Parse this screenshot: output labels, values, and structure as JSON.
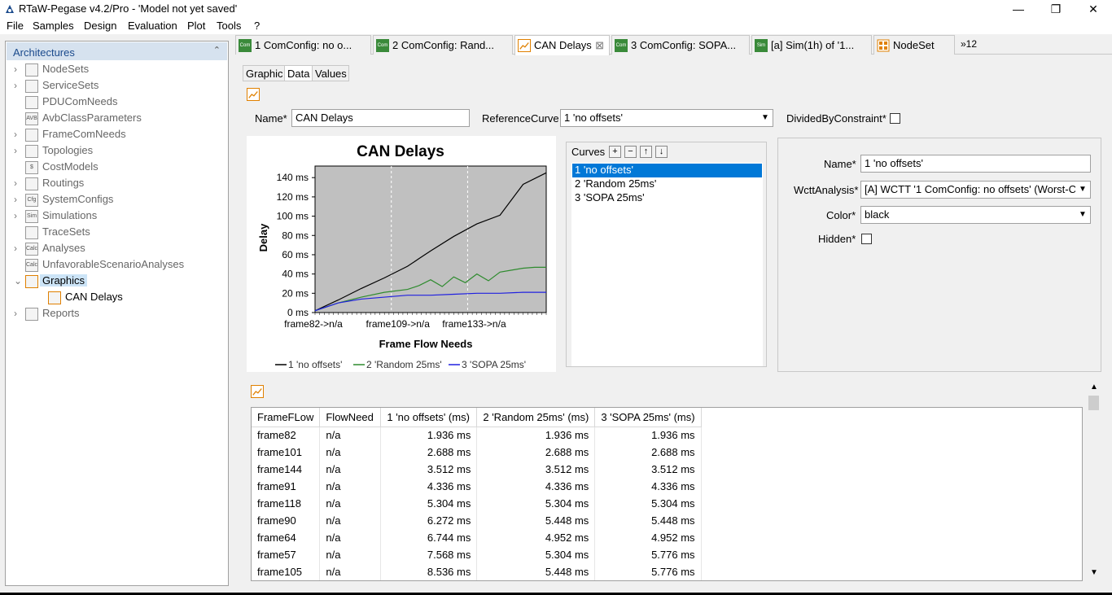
{
  "window": {
    "title": "RTaW-Pegase v4.2/Pro - 'Model not yet saved'",
    "minimize": "—",
    "maximize": "❐",
    "close": "✕"
  },
  "menu": [
    "File",
    "Samples",
    "Design",
    "Evaluation",
    "Plot",
    "Tools",
    "?"
  ],
  "sidebar": {
    "header": "Architectures",
    "items": [
      {
        "label": "NodeSets",
        "icon": "nodeset-icon",
        "badge": ""
      },
      {
        "label": "ServiceSets",
        "icon": "serviceset-icon",
        "badge": ""
      },
      {
        "label": "PDUComNeeds",
        "icon": "pdu-icon",
        "badge": ""
      },
      {
        "label": "AvbClassParameters",
        "icon": "avb-icon",
        "badge": "AVB"
      },
      {
        "label": "FrameComNeeds",
        "icon": "framecom-icon",
        "badge": ""
      },
      {
        "label": "Topologies",
        "icon": "topology-icon",
        "badge": ""
      },
      {
        "label": "CostModels",
        "icon": "cost-icon",
        "badge": "$"
      },
      {
        "label": "Routings",
        "icon": "routing-icon",
        "badge": ""
      },
      {
        "label": "SystemConfigs",
        "icon": "sysconfig-icon",
        "badge": "Cfg"
      },
      {
        "label": "Simulations",
        "icon": "simulation-icon",
        "badge": "Sim"
      },
      {
        "label": "TraceSets",
        "icon": "traceset-icon",
        "badge": ""
      },
      {
        "label": "Analyses",
        "icon": "analysis-icon",
        "badge": "Calc"
      },
      {
        "label": "UnfavorableScenarioAnalyses",
        "icon": "unfavorable-icon",
        "badge": "Calc"
      },
      {
        "label": "Graphics",
        "icon": "graphics-icon",
        "badge": ""
      },
      {
        "label": "CAN Delays",
        "icon": "chart-icon",
        "badge": ""
      },
      {
        "label": "Reports",
        "icon": "report-icon",
        "badge": ""
      }
    ]
  },
  "tabs": [
    {
      "label": "1 ComConfig: no o...",
      "badge": "Com"
    },
    {
      "label": "2 ComConfig: Rand...",
      "badge": "Com"
    },
    {
      "label": "CAN Delays",
      "badge": ""
    },
    {
      "label": "3 ComConfig: SOPA...",
      "badge": "Com"
    },
    {
      "label": "[a] Sim(1h) of '1...",
      "badge": "Sim"
    },
    {
      "label": "NodeSet",
      "badge": ""
    },
    {
      "label": "»12",
      "badge": ""
    }
  ],
  "subtabs": [
    "Graphic",
    "Data",
    "Values"
  ],
  "form": {
    "name_label": "Name*",
    "name_value": "CAN Delays",
    "refcurve_label": "ReferenceCurve",
    "refcurve_value": "1 'no offsets'",
    "divided_label": "DividedByConstraint*"
  },
  "curves": {
    "label": "Curves",
    "buttons": [
      "+",
      "−",
      "↑",
      "↓"
    ],
    "items": [
      "1 'no offsets'",
      "2 'Random 25ms'",
      "3 'SOPA 25ms'"
    ]
  },
  "props": {
    "name_label": "Name*",
    "name_value": "1 'no offsets'",
    "wctt_label": "WcttAnalysis*",
    "wctt_value": "[A] WCTT '1 ComConfig: no offsets' (Worst-C",
    "color_label": "Color*",
    "color_value": "black",
    "hidden_label": "Hidden*"
  },
  "chart_data": {
    "type": "line",
    "title": "CAN Delays",
    "xlabel": "Frame Flow Needs",
    "ylabel": "Delay",
    "xticks": [
      "frame82->n/a",
      "frame109->n/a",
      "frame133->n/a"
    ],
    "yticks": [
      "0 ms",
      "20 ms",
      "40 ms",
      "60 ms",
      "80 ms",
      "100 ms",
      "120 ms",
      "140 ms"
    ],
    "ylim": [
      0,
      152
    ],
    "grid": "vertical dashed",
    "legend_placement": "bottom",
    "plot_background": "#c0c0c0",
    "series": [
      {
        "name": "1 'no offsets'",
        "color": "#000000",
        "x": [
          0,
          10,
          20,
          30,
          40,
          45,
          50,
          60,
          70,
          80,
          90,
          100
        ],
        "values": [
          1.9,
          13,
          25,
          36,
          48,
          56,
          64,
          79,
          92,
          101,
          133,
          145
        ]
      },
      {
        "name": "2 'Random 25ms'",
        "color": "#2e8b2e",
        "x": [
          0,
          10,
          20,
          30,
          40,
          45,
          50,
          55,
          60,
          65,
          70,
          75,
          80,
          85,
          90,
          95,
          100
        ],
        "values": [
          1.9,
          10,
          16,
          21,
          24,
          28,
          34,
          27,
          37,
          31,
          40,
          33,
          42,
          44,
          46,
          47,
          47
        ]
      },
      {
        "name": "3 'SOPA 25ms'",
        "color": "#2020e0",
        "x": [
          0,
          10,
          20,
          30,
          40,
          50,
          60,
          70,
          80,
          90,
          100
        ],
        "values": [
          1.9,
          10,
          14,
          16,
          18,
          18,
          19,
          20,
          20,
          21,
          21
        ]
      }
    ]
  },
  "table": {
    "headers": [
      "FrameFLow",
      "FlowNeed",
      "1 'no offsets' (ms)",
      "2 'Random 25ms' (ms)",
      "3 'SOPA 25ms' (ms)"
    ],
    "rows": [
      [
        "frame82",
        "n/a",
        "1.936 ms",
        "1.936 ms",
        "1.936 ms"
      ],
      [
        "frame101",
        "n/a",
        "2.688 ms",
        "2.688 ms",
        "2.688 ms"
      ],
      [
        "frame144",
        "n/a",
        "3.512 ms",
        "3.512 ms",
        "3.512 ms"
      ],
      [
        "frame91",
        "n/a",
        "4.336 ms",
        "4.336 ms",
        "4.336 ms"
      ],
      [
        "frame118",
        "n/a",
        "5.304 ms",
        "5.304 ms",
        "5.304 ms"
      ],
      [
        "frame90",
        "n/a",
        "6.272 ms",
        "5.448 ms",
        "5.448 ms"
      ],
      [
        "frame64",
        "n/a",
        "6.744 ms",
        "4.952 ms",
        "4.952 ms"
      ],
      [
        "frame57",
        "n/a",
        "7.568 ms",
        "5.304 ms",
        "5.776 ms"
      ],
      [
        "frame105",
        "n/a",
        "8.536 ms",
        "5.448 ms",
        "5.776 ms"
      ]
    ]
  },
  "colors": {
    "accent": "#0078d7",
    "tab_icon_green": "#3a8a3a",
    "chart_icon_orange": "#e08000"
  }
}
